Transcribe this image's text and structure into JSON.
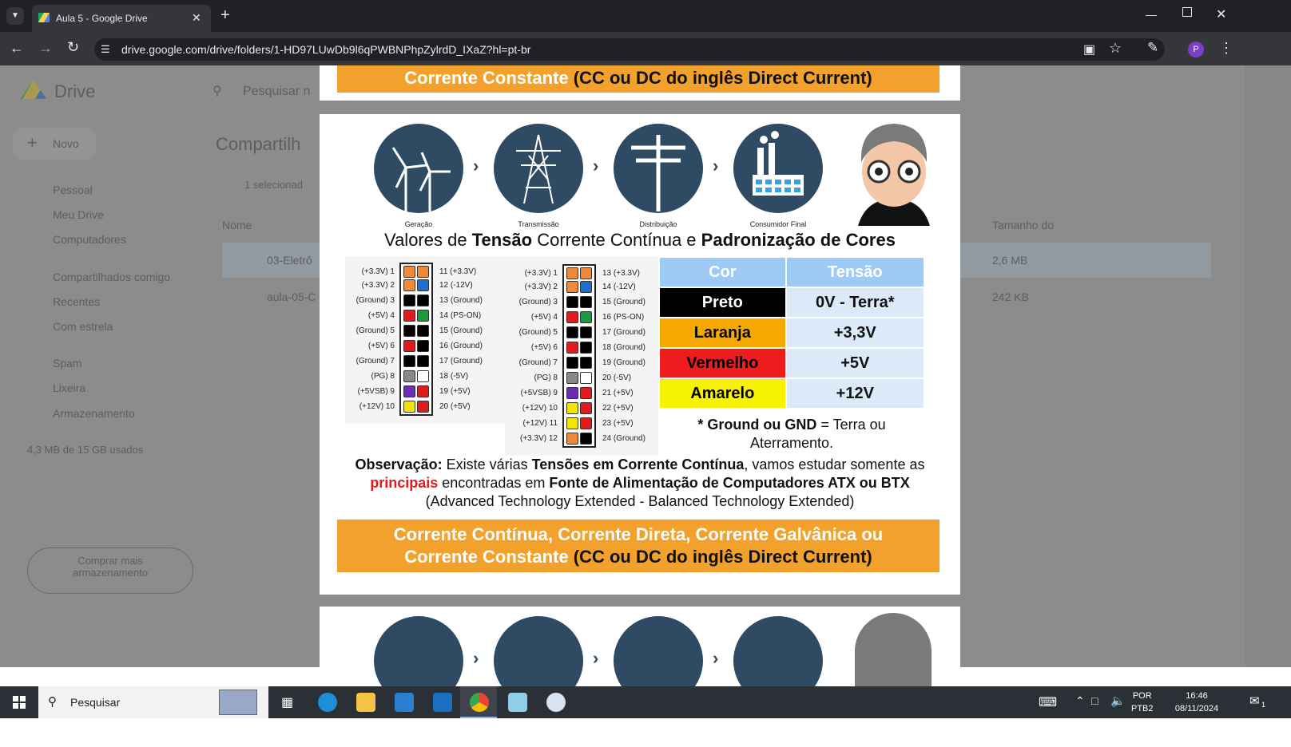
{
  "browser": {
    "tab_title": "Aula 5 - Google Drive",
    "url": "drive.google.com/drive/folders/1-HD97LUwDb9l6qPWBNPhpZylrdD_IXaZ?hl=pt-br",
    "new_tab": "+",
    "avatar_letter": "P"
  },
  "drive": {
    "logo": "Drive",
    "search_placeholder": "Pesquisar n",
    "new_button": "Novo",
    "page_title": "Compartilh",
    "selected": "1 selecionad",
    "sidebar": [
      "Pessoal",
      "Meu Drive",
      "Computadores",
      "Compartilhados comigo",
      "Recentes",
      "Com estrela",
      "Spam",
      "Lixeira",
      "Armazenamento"
    ],
    "storage_text": "4,3 MB de 15 GB usados",
    "buy_storage": "Comprar mais armazenamento",
    "col_name": "Nome",
    "col_size": "Tamanho do",
    "files": [
      {
        "name": "03-Eletrô",
        "size": "2,6 MB"
      },
      {
        "name": "aula-05-C",
        "size": "242 KB"
      }
    ]
  },
  "slide_top": {
    "banner_line2": "Corrente Constante ",
    "banner_line2_dark": "(CC ou DC do inglês Direct Current)"
  },
  "slide": {
    "icons": [
      "Geração",
      "Transmissão",
      "Distribuição",
      "Consumidor Final"
    ],
    "title_a": "Valores de ",
    "title_b": "Tensão",
    "title_c": " Corrente Contínua e ",
    "title_d": "Padronização de Cores",
    "table_head": [
      "Cor",
      "Tensão"
    ],
    "table_rows": [
      {
        "cor": "Preto",
        "tensao": "0V - Terra*",
        "bg": "#000000",
        "fg": "#ffffff"
      },
      {
        "cor": "Laranja",
        "tensao": "+3,3V",
        "bg": "#f5a800",
        "fg": "#000000"
      },
      {
        "cor": "Vermelho",
        "tensao": "+5V",
        "bg": "#ee1c1c",
        "fg": "#000000"
      },
      {
        "cor": "Amarelo",
        "tensao": "+12V",
        "bg": "#f7f300",
        "fg": "#000000"
      }
    ],
    "gnd_bold": "* Ground ou GND",
    "gnd_rest": " = Terra ou Aterramento.",
    "obs_bold": "Observação:",
    "obs_1": " Existe várias ",
    "obs_2": "Tensões em Corrente Contínua",
    "obs_3": ", vamos estudar somente as ",
    "obs_red": "principais",
    "obs_4": " encontradas em ",
    "obs_5": "Fonte de Alimentação de Computadores ATX ou BTX",
    "obs_6": "(Advanced Technology Extended - Balanced Technology Extended)",
    "banner_line1": "Corrente Contínua, Corrente Direta, Corrente Galvânica ou",
    "banner_line2": "Corrente Constante ",
    "banner_line2_dark": "(CC ou DC do inglês Direct Current)",
    "conn20_left": [
      "(+3.3V)  1",
      "(+3.3V)  2",
      "(Ground)  3",
      "(+5V)  4",
      "(Ground)  5",
      "(+5V)  6",
      "(Ground)  7",
      "(PG)  8",
      "(+5VSB)  9",
      "(+12V)  10"
    ],
    "conn20_right": [
      "11  (+3.3V)",
      "12  (-12V)",
      "13  (Ground)",
      "14  (PS-ON)",
      "15  (Ground)",
      "16  (Ground)",
      "17  (Ground)",
      "18  (-5V)",
      "19  (+5V)",
      "20  (+5V)"
    ],
    "conn24_left": [
      "(+3.3V)  1",
      "(+3.3V)  2",
      "(Ground)  3",
      "(+5V)  4",
      "(Ground)  5",
      "(+5V)  6",
      "(Ground)  7",
      "(PG)  8",
      "(+5VSB)  9",
      "(+12V)  10",
      "(+12V)  11",
      "(+3.3V)  12"
    ],
    "conn24_right": [
      "13  (+3.3V)",
      "14  (-12V)",
      "15  (Ground)",
      "16  (PS-ON)",
      "17  (Ground)",
      "18  (Ground)",
      "19  (Ground)",
      "20  (-5V)",
      "21  (+5V)",
      "22  (+5V)",
      "23  (+5V)",
      "24  (Ground)"
    ]
  },
  "taskbar": {
    "search": "Pesquisar",
    "lang1": "POR",
    "lang2": "PTB2",
    "time": "16:46",
    "date": "08/11/2024",
    "notif": "1"
  },
  "colors": {
    "orange": "#f2a12d",
    "navy": "#2f4a63",
    "table_head": "#9dcbf5",
    "table_cell": "#dbe9f8"
  }
}
